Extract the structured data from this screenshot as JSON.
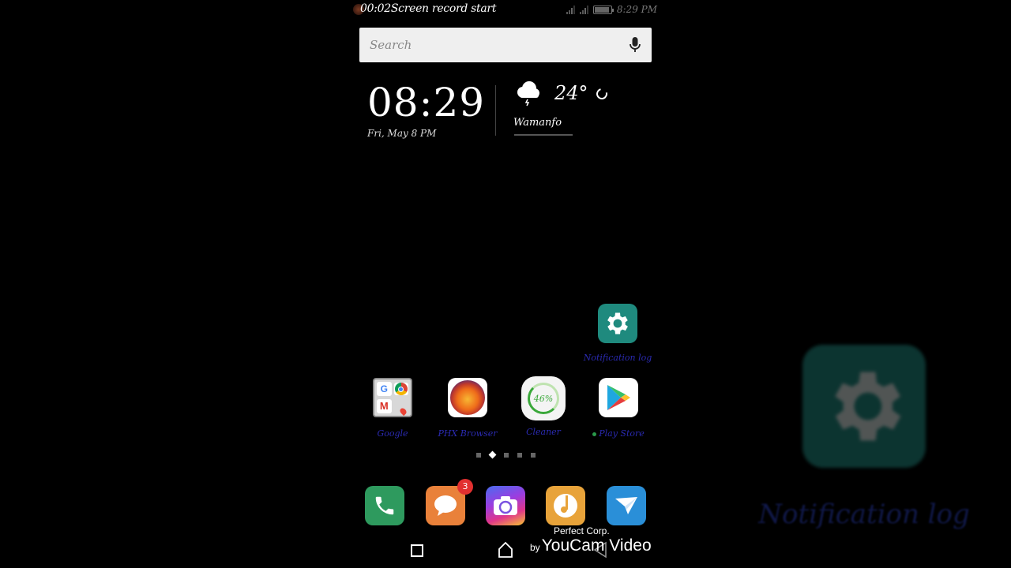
{
  "status_bar": {
    "recording_timer": "00:02",
    "recording_text": "Screen record start",
    "time": "8:29 PM",
    "battery_level_pct": 90
  },
  "search": {
    "placeholder": "Search",
    "value": "",
    "mic_icon": "mic-icon"
  },
  "clock_widget": {
    "time": "08:29",
    "date": "Fri, May 8   PM",
    "weather": {
      "icon": "thunderstorm-cloud-icon",
      "temperature": "24°",
      "unit_icon": "refresh-icon",
      "city": "Wamanfo"
    }
  },
  "home_apps": [
    {
      "label": "Notification log",
      "icon": "gear-icon",
      "color": "#1f8a7e"
    },
    {
      "label": "Google",
      "icon": "google-folder-icon",
      "color": "#e6e6e6"
    },
    {
      "label": "PHX Browser",
      "icon": "phoenix-icon",
      "color": "#ffffff"
    },
    {
      "label": "Cleaner",
      "icon": "cleaner-gauge-icon",
      "color": "#f4f4f4",
      "percent": "46%"
    },
    {
      "label": "Play Store",
      "icon": "play-store-icon",
      "color": "#ffffff",
      "new_dot": true
    }
  ],
  "page_indicator": {
    "count": 5,
    "active_index": 1
  },
  "dock": [
    {
      "name": "phone",
      "icon": "phone-icon",
      "color": "#2e9a5e"
    },
    {
      "name": "messages",
      "icon": "message-bubble-icon",
      "color": "#e9813a",
      "badge": "3"
    },
    {
      "name": "camera",
      "icon": "camera-icon",
      "color": "#7a52e0"
    },
    {
      "name": "music",
      "icon": "music-disc-icon",
      "color": "#e8a33a"
    },
    {
      "name": "email",
      "icon": "paper-plane-icon",
      "color": "#2a8fd8"
    }
  ],
  "nav_bar": {
    "recent": "recent-apps-icon",
    "home": "home-icon",
    "back": "back-icon"
  },
  "watermark": {
    "company": "Perfect Corp.",
    "by": "by",
    "product": "YouCam Video"
  },
  "background_ghost": {
    "label": "Notification log"
  },
  "colors": {
    "app_label": "#2a2ab0",
    "badge": "#e23030",
    "notification_log_teal": "#1f8a7e"
  }
}
